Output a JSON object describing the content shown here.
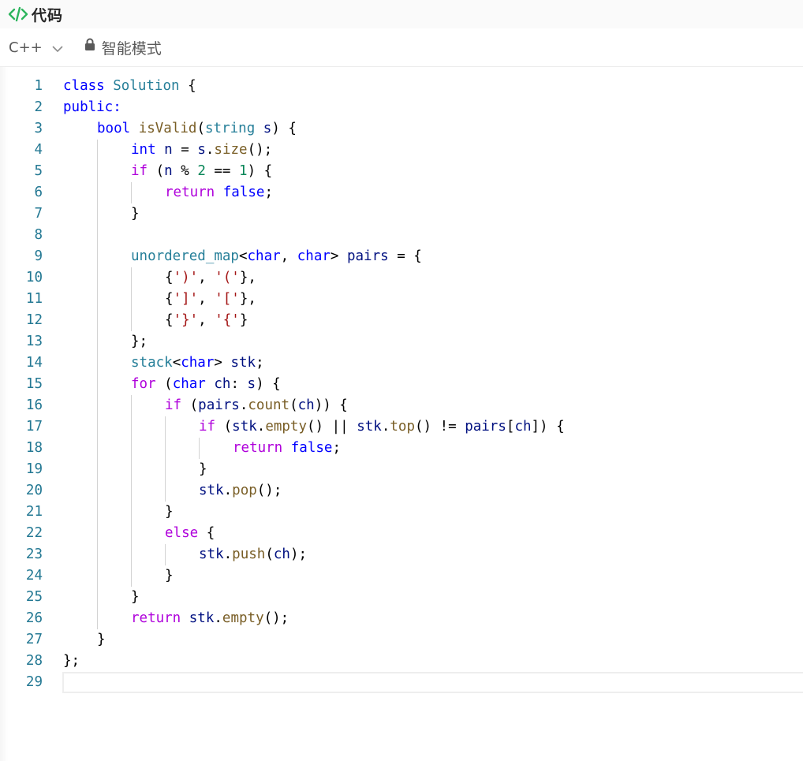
{
  "panel": {
    "title": "代码",
    "title_icon": "code-icon",
    "accent_color": "#2db55d"
  },
  "toolbar": {
    "language": "C++",
    "mode_label": "智能模式",
    "mode_icon": "lock-icon"
  },
  "editor": {
    "current_line": 29,
    "lines": [
      {
        "n": "1",
        "indent": 0,
        "tokens": [
          [
            "kw",
            "class"
          ],
          [
            "plain",
            " "
          ],
          [
            "type",
            "Solution"
          ],
          [
            "plain",
            " {"
          ]
        ]
      },
      {
        "n": "2",
        "indent": 0,
        "tokens": [
          [
            "kw",
            "public:"
          ]
        ]
      },
      {
        "n": "3",
        "indent": 1,
        "tokens": [
          [
            "kw",
            "bool"
          ],
          [
            "plain",
            " "
          ],
          [
            "fn",
            "isValid"
          ],
          [
            "plain",
            "("
          ],
          [
            "type",
            "string"
          ],
          [
            "plain",
            " "
          ],
          [
            "var",
            "s"
          ],
          [
            "plain",
            ") {"
          ]
        ]
      },
      {
        "n": "4",
        "indent": 2,
        "tokens": [
          [
            "kw",
            "int"
          ],
          [
            "plain",
            " "
          ],
          [
            "var",
            "n"
          ],
          [
            "plain",
            " = "
          ],
          [
            "var",
            "s"
          ],
          [
            "plain",
            "."
          ],
          [
            "fn",
            "size"
          ],
          [
            "plain",
            "();"
          ]
        ]
      },
      {
        "n": "5",
        "indent": 2,
        "tokens": [
          [
            "ctrl",
            "if"
          ],
          [
            "plain",
            " ("
          ],
          [
            "var",
            "n"
          ],
          [
            "plain",
            " % "
          ],
          [
            "num",
            "2"
          ],
          [
            "plain",
            " == "
          ],
          [
            "num",
            "1"
          ],
          [
            "plain",
            ") {"
          ]
        ]
      },
      {
        "n": "6",
        "indent": 3,
        "tokens": [
          [
            "ctrl",
            "return"
          ],
          [
            "plain",
            " "
          ],
          [
            "kw",
            "false"
          ],
          [
            "plain",
            ";"
          ]
        ]
      },
      {
        "n": "7",
        "indent": 2,
        "tokens": [
          [
            "plain",
            "}"
          ]
        ]
      },
      {
        "n": "8",
        "indent": 0,
        "tokens": []
      },
      {
        "n": "9",
        "indent": 2,
        "tokens": [
          [
            "type",
            "unordered_map"
          ],
          [
            "plain",
            "<"
          ],
          [
            "kw",
            "char"
          ],
          [
            "plain",
            ", "
          ],
          [
            "kw",
            "char"
          ],
          [
            "plain",
            "> "
          ],
          [
            "var",
            "pairs"
          ],
          [
            "plain",
            " = {"
          ]
        ]
      },
      {
        "n": "10",
        "indent": 3,
        "tokens": [
          [
            "plain",
            "{"
          ],
          [
            "str",
            "')'"
          ],
          [
            "plain",
            ", "
          ],
          [
            "str",
            "'('"
          ],
          [
            "plain",
            "},"
          ]
        ]
      },
      {
        "n": "11",
        "indent": 3,
        "tokens": [
          [
            "plain",
            "{"
          ],
          [
            "str",
            "']'"
          ],
          [
            "plain",
            ", "
          ],
          [
            "str",
            "'['"
          ],
          [
            "plain",
            "},"
          ]
        ]
      },
      {
        "n": "12",
        "indent": 3,
        "tokens": [
          [
            "plain",
            "{"
          ],
          [
            "str",
            "'}'"
          ],
          [
            "plain",
            ", "
          ],
          [
            "str",
            "'{'"
          ],
          [
            "plain",
            "}"
          ]
        ]
      },
      {
        "n": "13",
        "indent": 2,
        "tokens": [
          [
            "plain",
            "};"
          ]
        ]
      },
      {
        "n": "14",
        "indent": 2,
        "tokens": [
          [
            "type",
            "stack"
          ],
          [
            "plain",
            "<"
          ],
          [
            "kw",
            "char"
          ],
          [
            "plain",
            "> "
          ],
          [
            "var",
            "stk"
          ],
          [
            "plain",
            ";"
          ]
        ]
      },
      {
        "n": "15",
        "indent": 2,
        "tokens": [
          [
            "ctrl",
            "for"
          ],
          [
            "plain",
            " ("
          ],
          [
            "kw",
            "char"
          ],
          [
            "plain",
            " "
          ],
          [
            "var",
            "ch"
          ],
          [
            "plain",
            ": "
          ],
          [
            "var",
            "s"
          ],
          [
            "plain",
            ") {"
          ]
        ]
      },
      {
        "n": "16",
        "indent": 3,
        "tokens": [
          [
            "ctrl",
            "if"
          ],
          [
            "plain",
            " ("
          ],
          [
            "var",
            "pairs"
          ],
          [
            "plain",
            "."
          ],
          [
            "fn",
            "count"
          ],
          [
            "plain",
            "("
          ],
          [
            "var",
            "ch"
          ],
          [
            "plain",
            ")) {"
          ]
        ]
      },
      {
        "n": "17",
        "indent": 4,
        "tokens": [
          [
            "ctrl",
            "if"
          ],
          [
            "plain",
            " ("
          ],
          [
            "var",
            "stk"
          ],
          [
            "plain",
            "."
          ],
          [
            "fn",
            "empty"
          ],
          [
            "plain",
            "() || "
          ],
          [
            "var",
            "stk"
          ],
          [
            "plain",
            "."
          ],
          [
            "fn",
            "top"
          ],
          [
            "plain",
            "() != "
          ],
          [
            "var",
            "pairs"
          ],
          [
            "plain",
            "["
          ],
          [
            "var",
            "ch"
          ],
          [
            "plain",
            "]) {"
          ]
        ]
      },
      {
        "n": "18",
        "indent": 5,
        "tokens": [
          [
            "ctrl",
            "return"
          ],
          [
            "plain",
            " "
          ],
          [
            "kw",
            "false"
          ],
          [
            "plain",
            ";"
          ]
        ]
      },
      {
        "n": "19",
        "indent": 4,
        "tokens": [
          [
            "plain",
            "}"
          ]
        ]
      },
      {
        "n": "20",
        "indent": 4,
        "tokens": [
          [
            "var",
            "stk"
          ],
          [
            "plain",
            "."
          ],
          [
            "fn",
            "pop"
          ],
          [
            "plain",
            "();"
          ]
        ]
      },
      {
        "n": "21",
        "indent": 3,
        "tokens": [
          [
            "plain",
            "}"
          ]
        ]
      },
      {
        "n": "22",
        "indent": 3,
        "tokens": [
          [
            "ctrl",
            "else"
          ],
          [
            "plain",
            " {"
          ]
        ]
      },
      {
        "n": "23",
        "indent": 4,
        "tokens": [
          [
            "var",
            "stk"
          ],
          [
            "plain",
            "."
          ],
          [
            "fn",
            "push"
          ],
          [
            "plain",
            "("
          ],
          [
            "var",
            "ch"
          ],
          [
            "plain",
            ");"
          ]
        ]
      },
      {
        "n": "24",
        "indent": 3,
        "tokens": [
          [
            "plain",
            "}"
          ]
        ]
      },
      {
        "n": "25",
        "indent": 2,
        "tokens": [
          [
            "plain",
            "}"
          ]
        ]
      },
      {
        "n": "26",
        "indent": 2,
        "tokens": [
          [
            "ctrl",
            "return"
          ],
          [
            "plain",
            " "
          ],
          [
            "var",
            "stk"
          ],
          [
            "plain",
            "."
          ],
          [
            "fn",
            "empty"
          ],
          [
            "plain",
            "();"
          ]
        ]
      },
      {
        "n": "27",
        "indent": 1,
        "tokens": [
          [
            "plain",
            "}"
          ]
        ]
      },
      {
        "n": "28",
        "indent": 0,
        "tokens": [
          [
            "plain",
            "};"
          ]
        ]
      },
      {
        "n": "29",
        "indent": 0,
        "tokens": []
      }
    ]
  }
}
